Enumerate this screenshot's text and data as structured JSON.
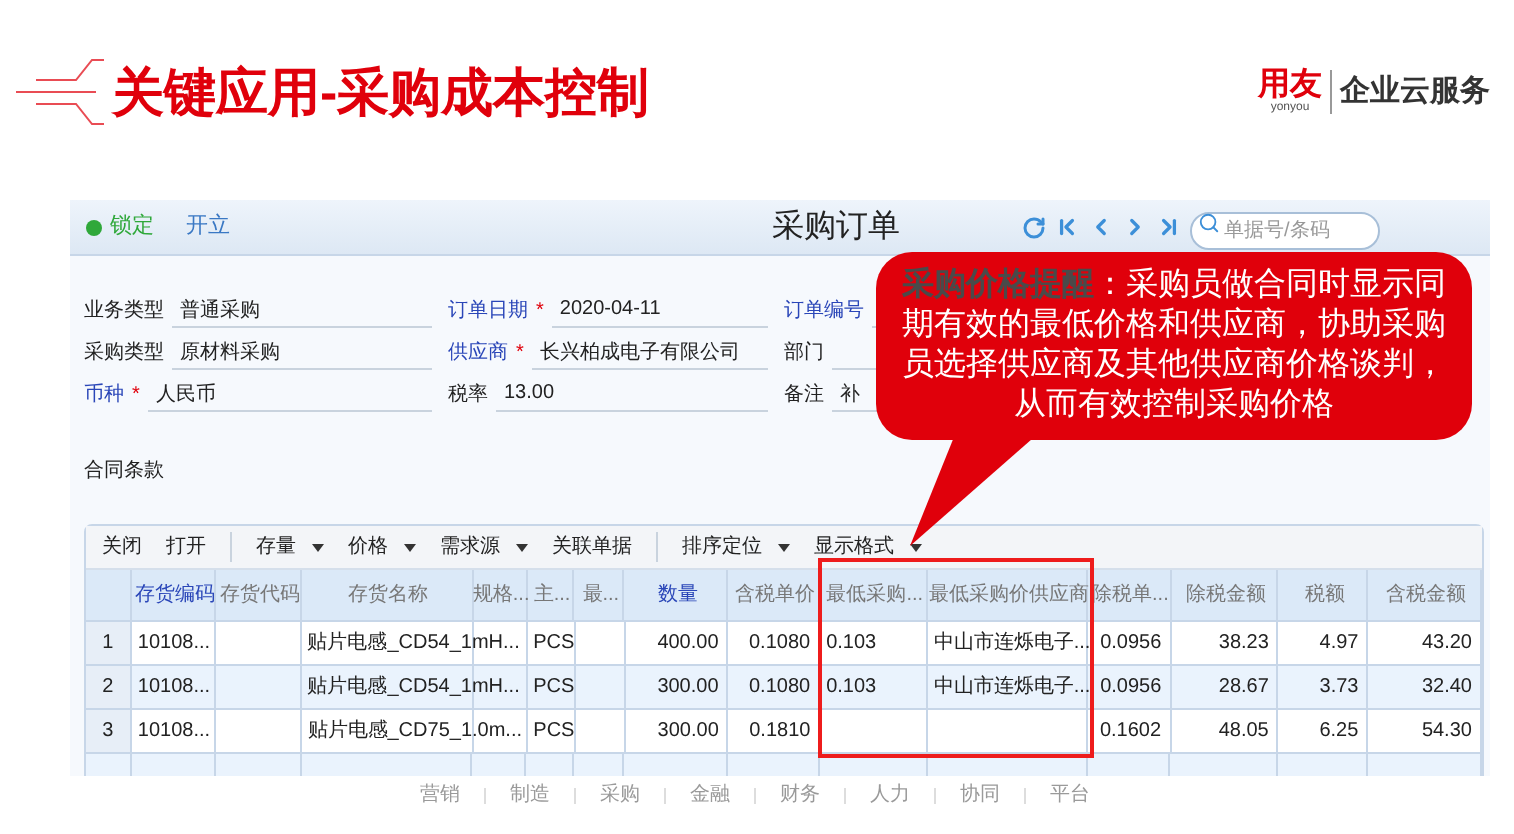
{
  "slide_title": "关键应用-采购成本控制",
  "brand": {
    "logo": "用友",
    "logo_sub": "yonyou",
    "tagline": "企业云服务"
  },
  "window": {
    "status": "锁定",
    "state": "开立",
    "title": "采购订单",
    "search": {
      "placeholder": "单据号/条码"
    }
  },
  "form": [
    {
      "label": "业务类型",
      "link": false,
      "required": false,
      "value": "普通采购"
    },
    {
      "label": "订单日期",
      "link": true,
      "required": true,
      "required_mark": "*",
      "value": "2020-04-11"
    },
    {
      "label": "订单编号",
      "link": true,
      "required": false
    },
    {
      "label": "采购类型",
      "link": false,
      "required": false,
      "value": "原材料采购"
    },
    {
      "label": "供应商",
      "link": true,
      "required": true,
      "required_mark": "*",
      "value": "长兴柏成电子有限公司"
    },
    {
      "label": "部门",
      "link": false,
      "required": false
    },
    {
      "label": "币种",
      "link": true,
      "required": true,
      "required_mark": "*",
      "value": "人民币"
    },
    {
      "label": "税率",
      "link": false,
      "required": false,
      "value": "13.00"
    },
    {
      "label": "备注",
      "link": false,
      "required": false,
      "value": "补"
    }
  ],
  "contract_label": "合同条款",
  "table_toolbar": [
    {
      "label": "关闭",
      "dropdown": false,
      "separator_before": false
    },
    {
      "label": "打开",
      "dropdown": false,
      "separator_before": false
    },
    {
      "label": "存量",
      "dropdown": true,
      "separator_before": true
    },
    {
      "label": "价格",
      "dropdown": true,
      "separator_before": false
    },
    {
      "label": "需求源",
      "dropdown": true,
      "separator_before": false
    },
    {
      "label": "关联单据",
      "dropdown": false,
      "separator_before": false
    },
    {
      "label": "排序定位",
      "dropdown": true,
      "separator_before": true
    },
    {
      "label": "显示格式",
      "dropdown": true,
      "separator_before": false
    }
  ],
  "table": {
    "columns": [
      {
        "label": "存货编码",
        "required": true,
        "kind": "attachment",
        "highlighted": false
      },
      {
        "label": "存货代码",
        "required": false,
        "kind": "text",
        "highlighted": false
      },
      {
        "label": "存货名称",
        "required": false,
        "kind": "attachment",
        "highlighted": false
      },
      {
        "label": "规格...",
        "required": false,
        "kind": "text",
        "highlighted": false
      },
      {
        "label": "主...",
        "required": false,
        "kind": "text",
        "highlighted": false
      },
      {
        "label": "最...",
        "required": false,
        "kind": "text",
        "highlighted": false
      },
      {
        "label": "数量",
        "required": true,
        "kind": "number",
        "highlighted": false
      },
      {
        "label": "含税单价",
        "required": false,
        "kind": "number",
        "highlighted": false
      },
      {
        "label": "最低采购...",
        "required": false,
        "kind": "text",
        "highlighted": true
      },
      {
        "label": "最低采购价供应商",
        "required": false,
        "kind": "text",
        "highlighted": true
      },
      {
        "label": "除税单...",
        "required": false,
        "kind": "number",
        "highlighted": false
      },
      {
        "label": "除税金额",
        "required": false,
        "kind": "number",
        "highlighted": false
      },
      {
        "label": "税额",
        "required": false,
        "kind": "number",
        "highlighted": false
      },
      {
        "label": "含税金额",
        "required": false,
        "kind": "number",
        "highlighted": false
      }
    ],
    "rows": [
      {
        "number": "1",
        "cells": [
          "10108...",
          "",
          "贴片电感_CD54_1mH...",
          "",
          "PCS",
          "",
          "400.00",
          "0.1080",
          "0.103",
          "中山市连烁电子...",
          "0.0956",
          "38.23",
          "4.97",
          "43.20"
        ]
      },
      {
        "number": "2",
        "cells": [
          "10108...",
          "",
          "贴片电感_CD54_1mH...",
          "",
          "PCS",
          "",
          "300.00",
          "0.1080",
          "0.103",
          "中山市连烁电子...",
          "0.0956",
          "28.67",
          "3.73",
          "32.40"
        ]
      },
      {
        "number": "3",
        "cells": [
          "10108...",
          "",
          "贴片电感_CD75_1.0m...",
          "",
          "PCS",
          "",
          "300.00",
          "0.1810",
          "",
          "",
          "0.1602",
          "48.05",
          "6.25",
          "54.30"
        ]
      }
    ]
  },
  "callout": {
    "text": "**采购价格提醒**：采购员做合同时显示同期有效的最低价格和供应商，协助采购员选择供应商及其他供应商价格谈判，从而有效控制采购价格"
  },
  "footer_nav": [
    "营销",
    "制造",
    "采购",
    "金融",
    "财务",
    "人力",
    "协同",
    "平台"
  ]
}
